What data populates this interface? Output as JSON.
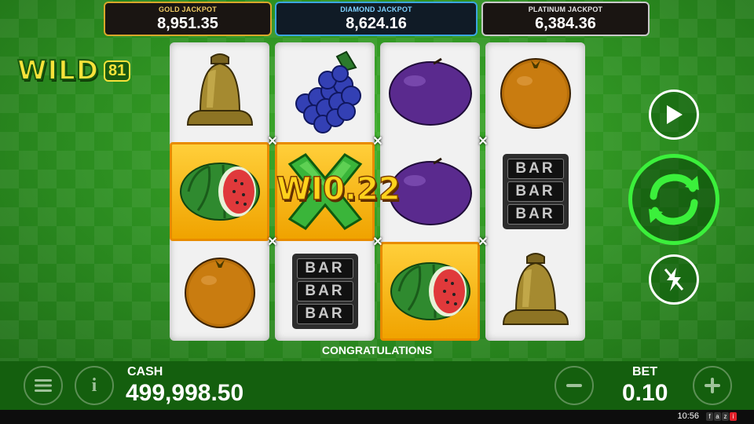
{
  "jackpots": [
    {
      "title": "GOLD JACKPOT",
      "value": "8,951.35"
    },
    {
      "title": "DIAMOND JACKPOT",
      "value": "8,624.16"
    },
    {
      "title": "PLATINUM JACKPOT",
      "value": "6,384.36"
    }
  ],
  "logo": {
    "word": "WILD",
    "number": "81"
  },
  "reels": [
    [
      "bell-icon",
      "watermelon-icon",
      "orange-icon"
    ],
    [
      "grapes-icon",
      "wild-x-icon",
      "bar-icon"
    ],
    [
      "plum-icon",
      "plum-icon",
      "watermelon-icon"
    ],
    [
      "orange-icon",
      "bar-icon",
      "bell-icon"
    ]
  ],
  "bar_text": "BAR",
  "win_text": "WI0.22",
  "message": "CONGRATULATIONS",
  "cash": {
    "label": "CASH",
    "value": "499,998.50"
  },
  "bet": {
    "label": "BET",
    "value": "0.10"
  },
  "status_bar": {
    "time": "10:56",
    "brand_letters": [
      "f",
      "a",
      "z",
      "i"
    ]
  },
  "colors": {
    "spin_accent": "#3bf03b",
    "win_highlight": "#ffcf3a",
    "gold": "#d8a72a",
    "diamond": "#3aa6e0"
  }
}
